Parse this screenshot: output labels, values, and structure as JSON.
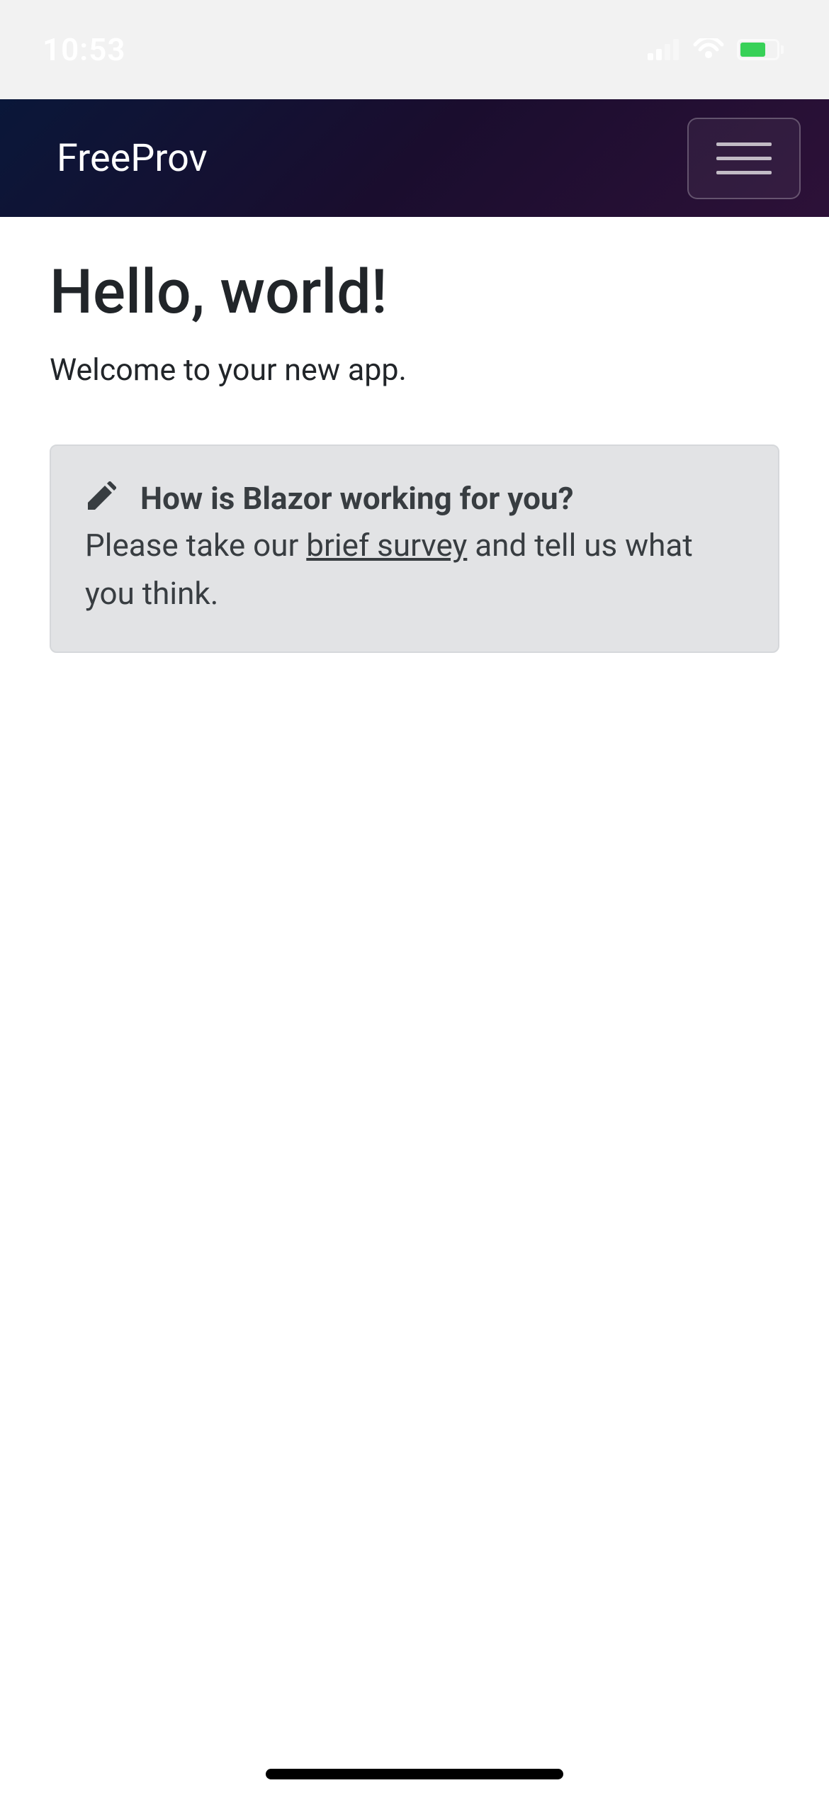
{
  "statusBar": {
    "time": "10:53"
  },
  "navBar": {
    "brand": "FreeProv"
  },
  "main": {
    "title": "Hello, world!",
    "subtitle": "Welcome to your new app."
  },
  "alert": {
    "title": "How is Blazor working for you?",
    "body_before": "Please take our ",
    "link_text": "brief survey",
    "body_after": " and tell us what you think."
  }
}
